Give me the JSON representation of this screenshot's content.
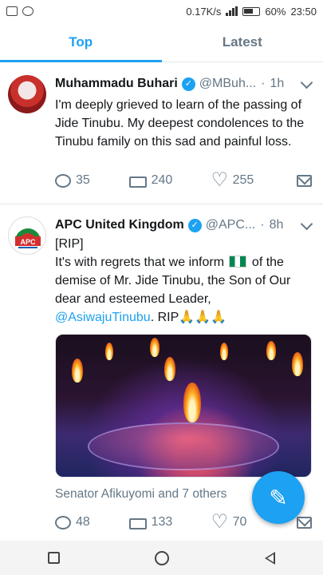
{
  "status_bar": {
    "speed": "0.17K/s",
    "battery": "60%",
    "time": "23:50"
  },
  "tabs": [
    {
      "label": "Top",
      "active": true
    },
    {
      "label": "Latest",
      "active": false
    }
  ],
  "tweets": [
    {
      "name": "Muhammadu Buhari",
      "handle": "@MBuh...",
      "dot": "·",
      "time": "1h",
      "text": "I'm deeply grieved to learn of the passing of Jide Tinubu. My deepest condolences to the Tinubu family on this sad and painful loss.",
      "replies": "35",
      "retweets": "240",
      "likes": "255"
    },
    {
      "name": "APC United Kingdom",
      "handle": "@APC...",
      "dot": "·",
      "time": "8h",
      "line1": "[RIP]",
      "text_a": "It's with regrets that we inform",
      "text_b": "of the demise of Mr. Jide Tinubu, the Son of Our dear and esteemed Leader,",
      "mention": "@AsiwajuTinubu",
      "text_c": ". RIP",
      "hands": "🙏🙏🙏",
      "social_context": "Senator Afikuyomi and 7 others",
      "replies": "48",
      "retweets": "133",
      "likes": "70"
    }
  ],
  "colors": {
    "accent": "#1da1f2",
    "secondary_text": "#657786"
  },
  "icons": [
    "reply-icon",
    "retweet-icon",
    "like-icon",
    "direct-message-icon",
    "compose-icon",
    "verified-icon",
    "chevron-down-icon"
  ]
}
